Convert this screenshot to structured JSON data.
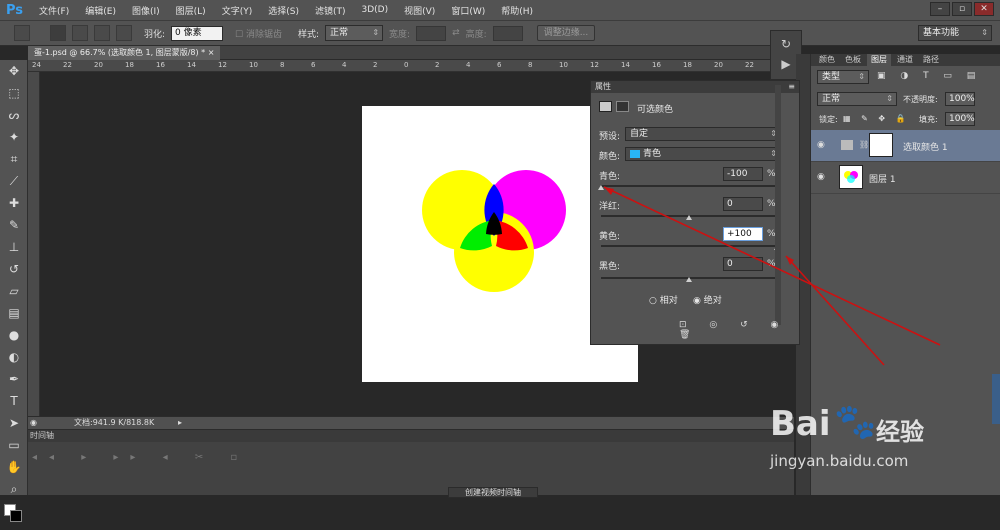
{
  "app": {
    "logo": "Ps",
    "workspace": "基本功能"
  },
  "menu": [
    "文件(F)",
    "编辑(E)",
    "图像(I)",
    "图层(L)",
    "文字(Y)",
    "选择(S)",
    "滤镜(T)",
    "3D(D)",
    "视图(V)",
    "窗口(W)",
    "帮助(H)"
  ],
  "window_controls": {
    "minimize": "–",
    "restore": "▫",
    "close": "✕"
  },
  "options": {
    "feather_label": "羽化:",
    "feather_value": "0 像素",
    "antialias_label": "消除锯齿",
    "style_label": "样式:",
    "style_value": "正常",
    "width_label": "宽度:",
    "height_label": "高度:",
    "refine_button": "调整边缘..."
  },
  "document": {
    "tab_title": "蛋-1.psd @ 66.7% (选取颜色 1, 图层蒙版/8) *",
    "tab_close": "×",
    "status": "文档:941.9 K/818.8K",
    "ruler_labels": [
      "24",
      "22",
      "20",
      "18",
      "16",
      "14",
      "12",
      "10",
      "8",
      "6",
      "4",
      "2",
      "0",
      "2",
      "4",
      "6",
      "8",
      "10",
      "12",
      "14",
      "16",
      "18",
      "20",
      "22",
      "24"
    ]
  },
  "timeline": {
    "label": "时间轴",
    "create_button": "创建视频时间轴"
  },
  "properties": {
    "header": "属性",
    "title": "可选颜色",
    "preset_label": "预设:",
    "preset_value": "自定",
    "colors_label": "颜色:",
    "colors_value": "青色",
    "colors_swatch": "#29b6f6",
    "sliders": [
      {
        "label": "青色:",
        "value": "-100",
        "percent": 0.0
      },
      {
        "label": "洋红:",
        "value": "0",
        "percent": 0.5
      },
      {
        "label": "黄色:",
        "value": "+100",
        "percent": 1.0
      },
      {
        "label": "黑色:",
        "value": "0",
        "percent": 0.5
      }
    ],
    "pct_sign": "%",
    "relative": "相对",
    "absolute": "绝对"
  },
  "layers_panel": {
    "tabs": [
      "颜色",
      "色板",
      "图层",
      "通道",
      "路径"
    ],
    "filter_value": "类型",
    "blend_value": "正常",
    "opacity_label": "不透明度:",
    "opacity_value": "100%",
    "lock_label": "锁定:",
    "fill_label": "填充:",
    "fill_value": "100%",
    "layers": [
      {
        "name": "选取颜色 1"
      },
      {
        "name": "图层 1"
      }
    ]
  },
  "watermark": {
    "brand": "Bai",
    "brand2": "经验",
    "url": "jingyan.baidu.com"
  },
  "colors": {
    "accent": "#3aa0f0",
    "annotation": "#cc1111"
  }
}
